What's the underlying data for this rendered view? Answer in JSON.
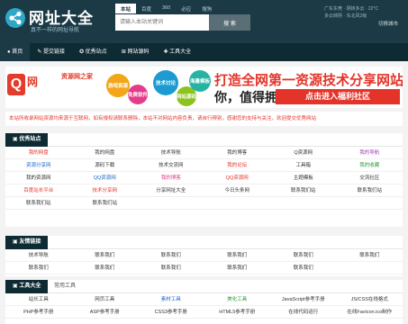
{
  "header": {
    "site_title": "网址大全",
    "site_subtitle": "真不一样的网址导航",
    "search_tabs": [
      "本站",
      "百度",
      "360",
      "必应",
      "搜狗"
    ],
    "search_placeholder": "请输入本站关键词",
    "search_button": "搜 索",
    "top_right_line1": "广东东莞 · 阴转多云 · 22°C",
    "top_right_line2": "多云转阴 · 东北风2级",
    "weather_label": "切换城市"
  },
  "nav": {
    "items": [
      "首页",
      "提交链接",
      "优秀站点",
      "网站源码",
      "工具大全"
    ]
  },
  "banner": {
    "q_letter": "Q",
    "q_text": "网",
    "q_sub": "资源网之家",
    "bubbles": [
      "游戏资源",
      "免费软件",
      "技术讨论",
      "网站源码",
      "海量模板"
    ],
    "slogan_line1": "打造全网第一资源技术分享网站",
    "slogan_line2": "你，值得拥有!",
    "slogan_button": "点击进入福利社区"
  },
  "notice": {
    "text": "本站所收录网站资源均来源于互联网，如有侵权请联系删除，本站不对网站内容负责，请自行辨别，感谢您的支持与关注，欢迎提交优秀网站"
  },
  "sections": {
    "featured": {
      "title": "优秀站点",
      "rows": [
        [
          "我的网盘",
          "我的网盘",
          "技术导航",
          "我的博客",
          "Q资源网",
          "我的导航"
        ],
        [
          "资源分享网",
          "源码下载",
          "技术交流网",
          "我的论坛",
          "工具箱",
          "我的收藏"
        ],
        [
          "我的资源网",
          "QQ资源网",
          "我的博客",
          "QQ资源网",
          "主题模板",
          "交流社区"
        ],
        [
          "百度站长平台",
          "技术分享网",
          "分享网址大全",
          "今日头条网",
          "联系我们站",
          "联系我们站"
        ],
        [
          "联系我们站",
          "联系我们站",
          "",
          "",
          "",
          ""
        ]
      ]
    },
    "links": {
      "title": "友情链接",
      "rows": [
        [
          "技术导航",
          "联系我们",
          "联系我们",
          "联系我们",
          "联系我们",
          "联系我们"
        ],
        [
          "联系我们",
          "联系我们",
          "联系我们",
          "联系我们",
          "联系我们",
          ""
        ]
      ]
    },
    "tools": {
      "title": "工具大全",
      "tab2": "常用工具",
      "rows": [
        [
          "站长工具",
          "网页工具",
          "素材工具",
          "美化工具",
          "JavaScript参考手册",
          "JS/CSS在线格式"
        ],
        [
          "PHP参考手册",
          "ASP参考手册",
          "CSS3参考手册",
          "HTML5参考手册",
          "在线代码运行",
          "在线Favicon.ico制作"
        ]
      ]
    }
  },
  "colors": {
    "header_bg": "#1b3a45",
    "nav_bg": "#0e2a33",
    "accent_red": "#e4342a",
    "accent_blue": "#2fa8c8"
  }
}
